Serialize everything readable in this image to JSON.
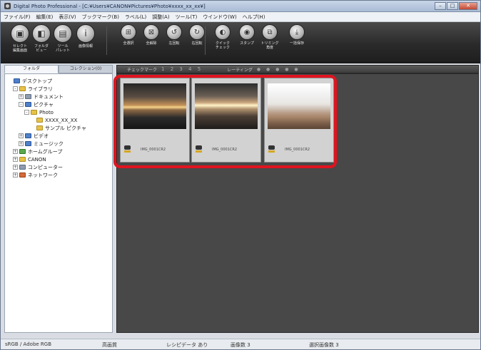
{
  "window": {
    "title": "Digital Photo Professional - [C:¥Users¥CANON¥Pictures¥Photo¥xxxx_xx_xx¥]",
    "controls": {
      "minimize": "–",
      "maximize": "□",
      "close": "✕"
    }
  },
  "menu": [
    "ファイル(F)",
    "編集(E)",
    "表示(V)",
    "ブックマーク(B)",
    "ラベル(L)",
    "調整(A)",
    "ツール(T)",
    "ウインドウ(W)",
    "ヘルプ(H)"
  ],
  "toolbar": [
    {
      "label": "セレクト\n編集画面",
      "icon": "select-edit-icon",
      "glyph": "▣"
    },
    {
      "label": "フォルダ\nビュー",
      "icon": "folder-view-icon",
      "glyph": "◧"
    },
    {
      "label": "ツール\nパレット",
      "icon": "tool-palette-icon",
      "glyph": "▤"
    },
    {
      "label": "画像情報",
      "icon": "info-icon",
      "glyph": "i"
    },
    {
      "label": "全選択",
      "icon": "select-all-icon",
      "glyph": "⊞"
    },
    {
      "label": "全解除",
      "icon": "deselect-all-icon",
      "glyph": "⊠"
    },
    {
      "label": "左回転",
      "icon": "rotate-left-icon",
      "glyph": "↺"
    },
    {
      "label": "右回転",
      "icon": "rotate-right-icon",
      "glyph": "↻"
    },
    {
      "label": "クイック\nチェック",
      "icon": "quick-check-icon",
      "glyph": "◐"
    },
    {
      "label": "スタンプ",
      "icon": "stamp-icon",
      "glyph": "◉"
    },
    {
      "label": "トリミング\n角度",
      "icon": "trim-icon",
      "glyph": "⧉"
    },
    {
      "label": "一括保存",
      "icon": "batch-save-icon",
      "glyph": "⤓"
    }
  ],
  "left_tabs": [
    "フォルダ",
    "コレクション(0)"
  ],
  "tree": [
    {
      "label": "デスクトップ",
      "indent": 0,
      "icon": "f-blue",
      "exp": ""
    },
    {
      "label": "ライブラリ",
      "indent": 1,
      "icon": "f-yellow",
      "exp": "-"
    },
    {
      "label": "ドキュメント",
      "indent": 2,
      "icon": "f-gray",
      "exp": "+"
    },
    {
      "label": "ピクチャ",
      "indent": 2,
      "icon": "f-blue",
      "exp": "-"
    },
    {
      "label": "Photo",
      "indent": 3,
      "icon": "f-yellow",
      "exp": "-"
    },
    {
      "label": "XXXX_XX_XX",
      "indent": 4,
      "icon": "f-yellow",
      "exp": ""
    },
    {
      "label": "サンプル ピクチャ",
      "indent": 4,
      "icon": "f-yellow",
      "exp": ""
    },
    {
      "label": "ビデオ",
      "indent": 2,
      "icon": "f-blue",
      "exp": "+"
    },
    {
      "label": "ミュージック",
      "indent": 2,
      "icon": "f-blue",
      "exp": "+"
    },
    {
      "label": "ホームグループ",
      "indent": 1,
      "icon": "f-green",
      "exp": "+"
    },
    {
      "label": "CANON",
      "indent": 1,
      "icon": "f-yellow",
      "exp": "+"
    },
    {
      "label": "コンピューター",
      "indent": 1,
      "icon": "f-gray",
      "exp": "+"
    },
    {
      "label": "ネットワーク",
      "indent": 1,
      "icon": "f-red",
      "exp": "+"
    }
  ],
  "header": {
    "check_label": "チェックマーク",
    "check_nums": "1 2 3 4 5",
    "rating_label": "レーティング",
    "rating_dots": "● ● ● ● ●"
  },
  "thumbnails": [
    {
      "filename": "IMG_0001CR2",
      "style": "img1"
    },
    {
      "filename": "IMG_0001CR2",
      "style": "img2"
    },
    {
      "filename": "IMG_0001CR2",
      "style": "img3"
    }
  ],
  "status": {
    "color_space": "sRGB / Adobe RGB",
    "quality": "高画質",
    "recipe": "レシピデータ あり",
    "image_count": "画像数 3",
    "selected_count": "選択画像数 3"
  },
  "colors": {
    "highlight": "#e0141f",
    "content_bg": "#484848"
  }
}
